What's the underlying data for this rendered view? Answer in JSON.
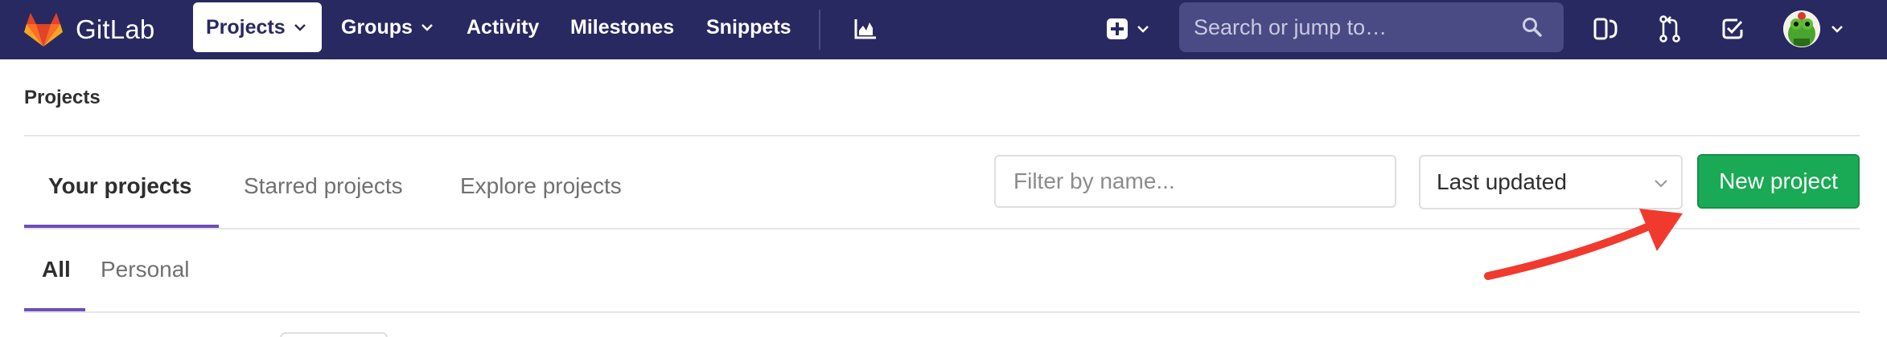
{
  "navbar": {
    "brand": "GitLab",
    "items": [
      {
        "label": "Projects",
        "active": true,
        "dropdown": true
      },
      {
        "label": "Groups",
        "active": false,
        "dropdown": true
      },
      {
        "label": "Activity",
        "active": false,
        "dropdown": false
      },
      {
        "label": "Milestones",
        "active": false,
        "dropdown": false
      },
      {
        "label": "Snippets",
        "active": false,
        "dropdown": false
      }
    ],
    "icons": [
      "chart-icon",
      "plus-square-icon",
      "sidebar-toggle-icon",
      "merge-request-icon",
      "todo-check-icon",
      "avatar"
    ],
    "search_placeholder": "Search or jump to…",
    "colors": {
      "background": "#292961",
      "search_bg": "#4a4a85",
      "accent": "#fc6d26"
    }
  },
  "breadcrumb": "Projects",
  "tabs": [
    {
      "label": "Your projects",
      "active": true
    },
    {
      "label": "Starred projects",
      "active": false
    },
    {
      "label": "Explore projects",
      "active": false
    }
  ],
  "filter": {
    "placeholder": "Filter by name..."
  },
  "sort": {
    "selected": "Last updated"
  },
  "new_project_button": "New project",
  "subtabs": [
    {
      "label": "All",
      "active": true
    },
    {
      "label": "Personal",
      "active": false
    }
  ],
  "colors": {
    "primary_button": "#1aaa55",
    "tab_underline": "#6b4fbb",
    "annotation_arrow": "#f03a2e"
  }
}
